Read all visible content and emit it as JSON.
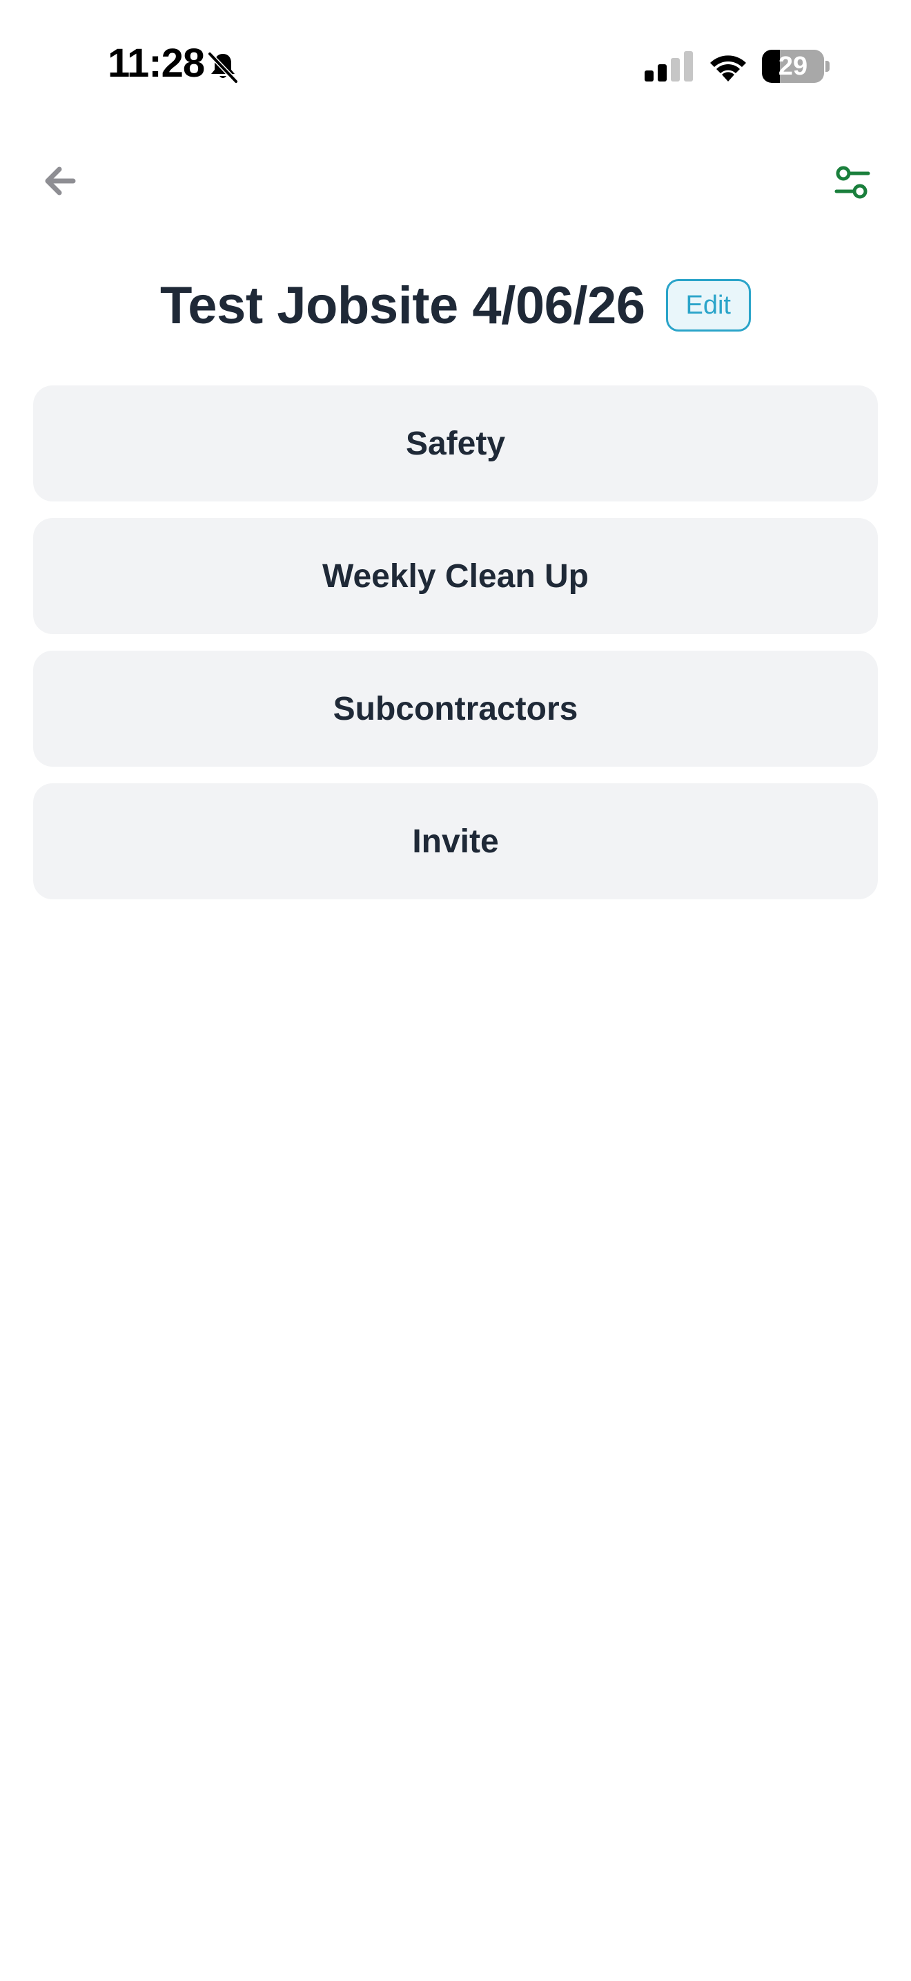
{
  "status_bar": {
    "time": "11:28",
    "battery_level": "29",
    "icons": [
      "bell-slash-icon",
      "cellular-signal-icon",
      "wifi-icon",
      "battery-icon"
    ]
  },
  "nav": {
    "back_icon": "arrow-left-icon",
    "settings_icon": "sliders-icon",
    "accent_color": "#1a7f3c",
    "back_color": "#8e8e93"
  },
  "header": {
    "title": "Test Jobsite 4/06/26",
    "edit_label": "Edit",
    "edit_color": "#2aa4c9"
  },
  "menu": {
    "items": [
      {
        "label": "Safety"
      },
      {
        "label": "Weekly Clean Up"
      },
      {
        "label": "Subcontractors"
      },
      {
        "label": "Invite"
      }
    ]
  }
}
